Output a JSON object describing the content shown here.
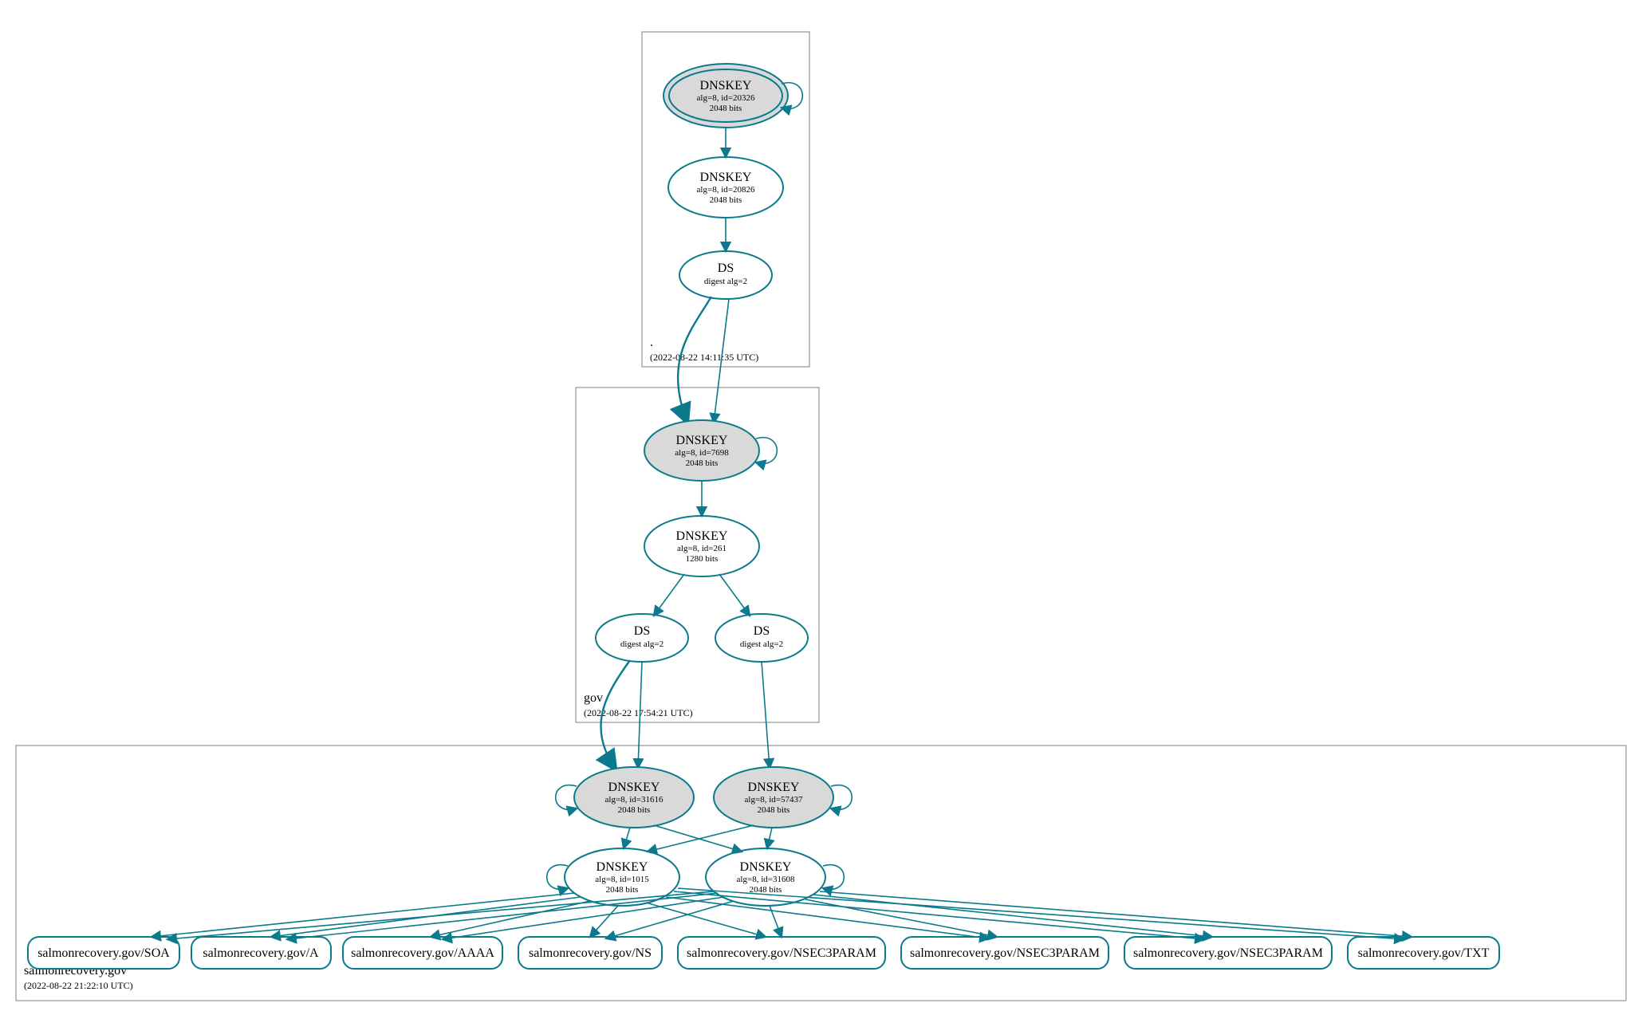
{
  "colors": {
    "stroke": "#0a7a8c",
    "sep_fill": "#d9d9d9",
    "box_stroke": "#7f7f7f"
  },
  "zones": {
    "root": {
      "name": ".",
      "timestamp": "(2022-08-22 14:11:35 UTC)"
    },
    "gov": {
      "name": "gov",
      "timestamp": "(2022-08-22 17:54:21 UTC)"
    },
    "sr": {
      "name": "salmonrecovery.gov",
      "timestamp": "(2022-08-22 21:22:10 UTC)"
    }
  },
  "nodes": {
    "root_ksk": {
      "line1": "DNSKEY",
      "line2": "alg=8, id=20326",
      "line3": "2048 bits"
    },
    "root_zsk": {
      "line1": "DNSKEY",
      "line2": "alg=8, id=20826",
      "line3": "2048 bits"
    },
    "root_ds": {
      "line1": "DS",
      "line2": "digest alg=2"
    },
    "gov_ksk": {
      "line1": "DNSKEY",
      "line2": "alg=8, id=7698",
      "line3": "2048 bits"
    },
    "gov_zsk": {
      "line1": "DNSKEY",
      "line2": "alg=8, id=261",
      "line3": "1280 bits"
    },
    "gov_ds1": {
      "line1": "DS",
      "line2": "digest alg=2"
    },
    "gov_ds2": {
      "line1": "DS",
      "line2": "digest alg=2"
    },
    "sr_ksk1": {
      "line1": "DNSKEY",
      "line2": "alg=8, id=31616",
      "line3": "2048 bits"
    },
    "sr_ksk2": {
      "line1": "DNSKEY",
      "line2": "alg=8, id=57437",
      "line3": "2048 bits"
    },
    "sr_zsk1": {
      "line1": "DNSKEY",
      "line2": "alg=8, id=1015",
      "line3": "2048 bits"
    },
    "sr_zsk2": {
      "line1": "DNSKEY",
      "line2": "alg=8, id=31608",
      "line3": "2048 bits"
    },
    "rr0": {
      "label": "salmonrecovery.gov/SOA"
    },
    "rr1": {
      "label": "salmonrecovery.gov/A"
    },
    "rr2": {
      "label": "salmonrecovery.gov/AAAA"
    },
    "rr3": {
      "label": "salmonrecovery.gov/NS"
    },
    "rr4": {
      "label": "salmonrecovery.gov/NSEC3PARAM"
    },
    "rr5": {
      "label": "salmonrecovery.gov/NSEC3PARAM"
    },
    "rr6": {
      "label": "salmonrecovery.gov/NSEC3PARAM"
    },
    "rr7": {
      "label": "salmonrecovery.gov/TXT"
    }
  }
}
